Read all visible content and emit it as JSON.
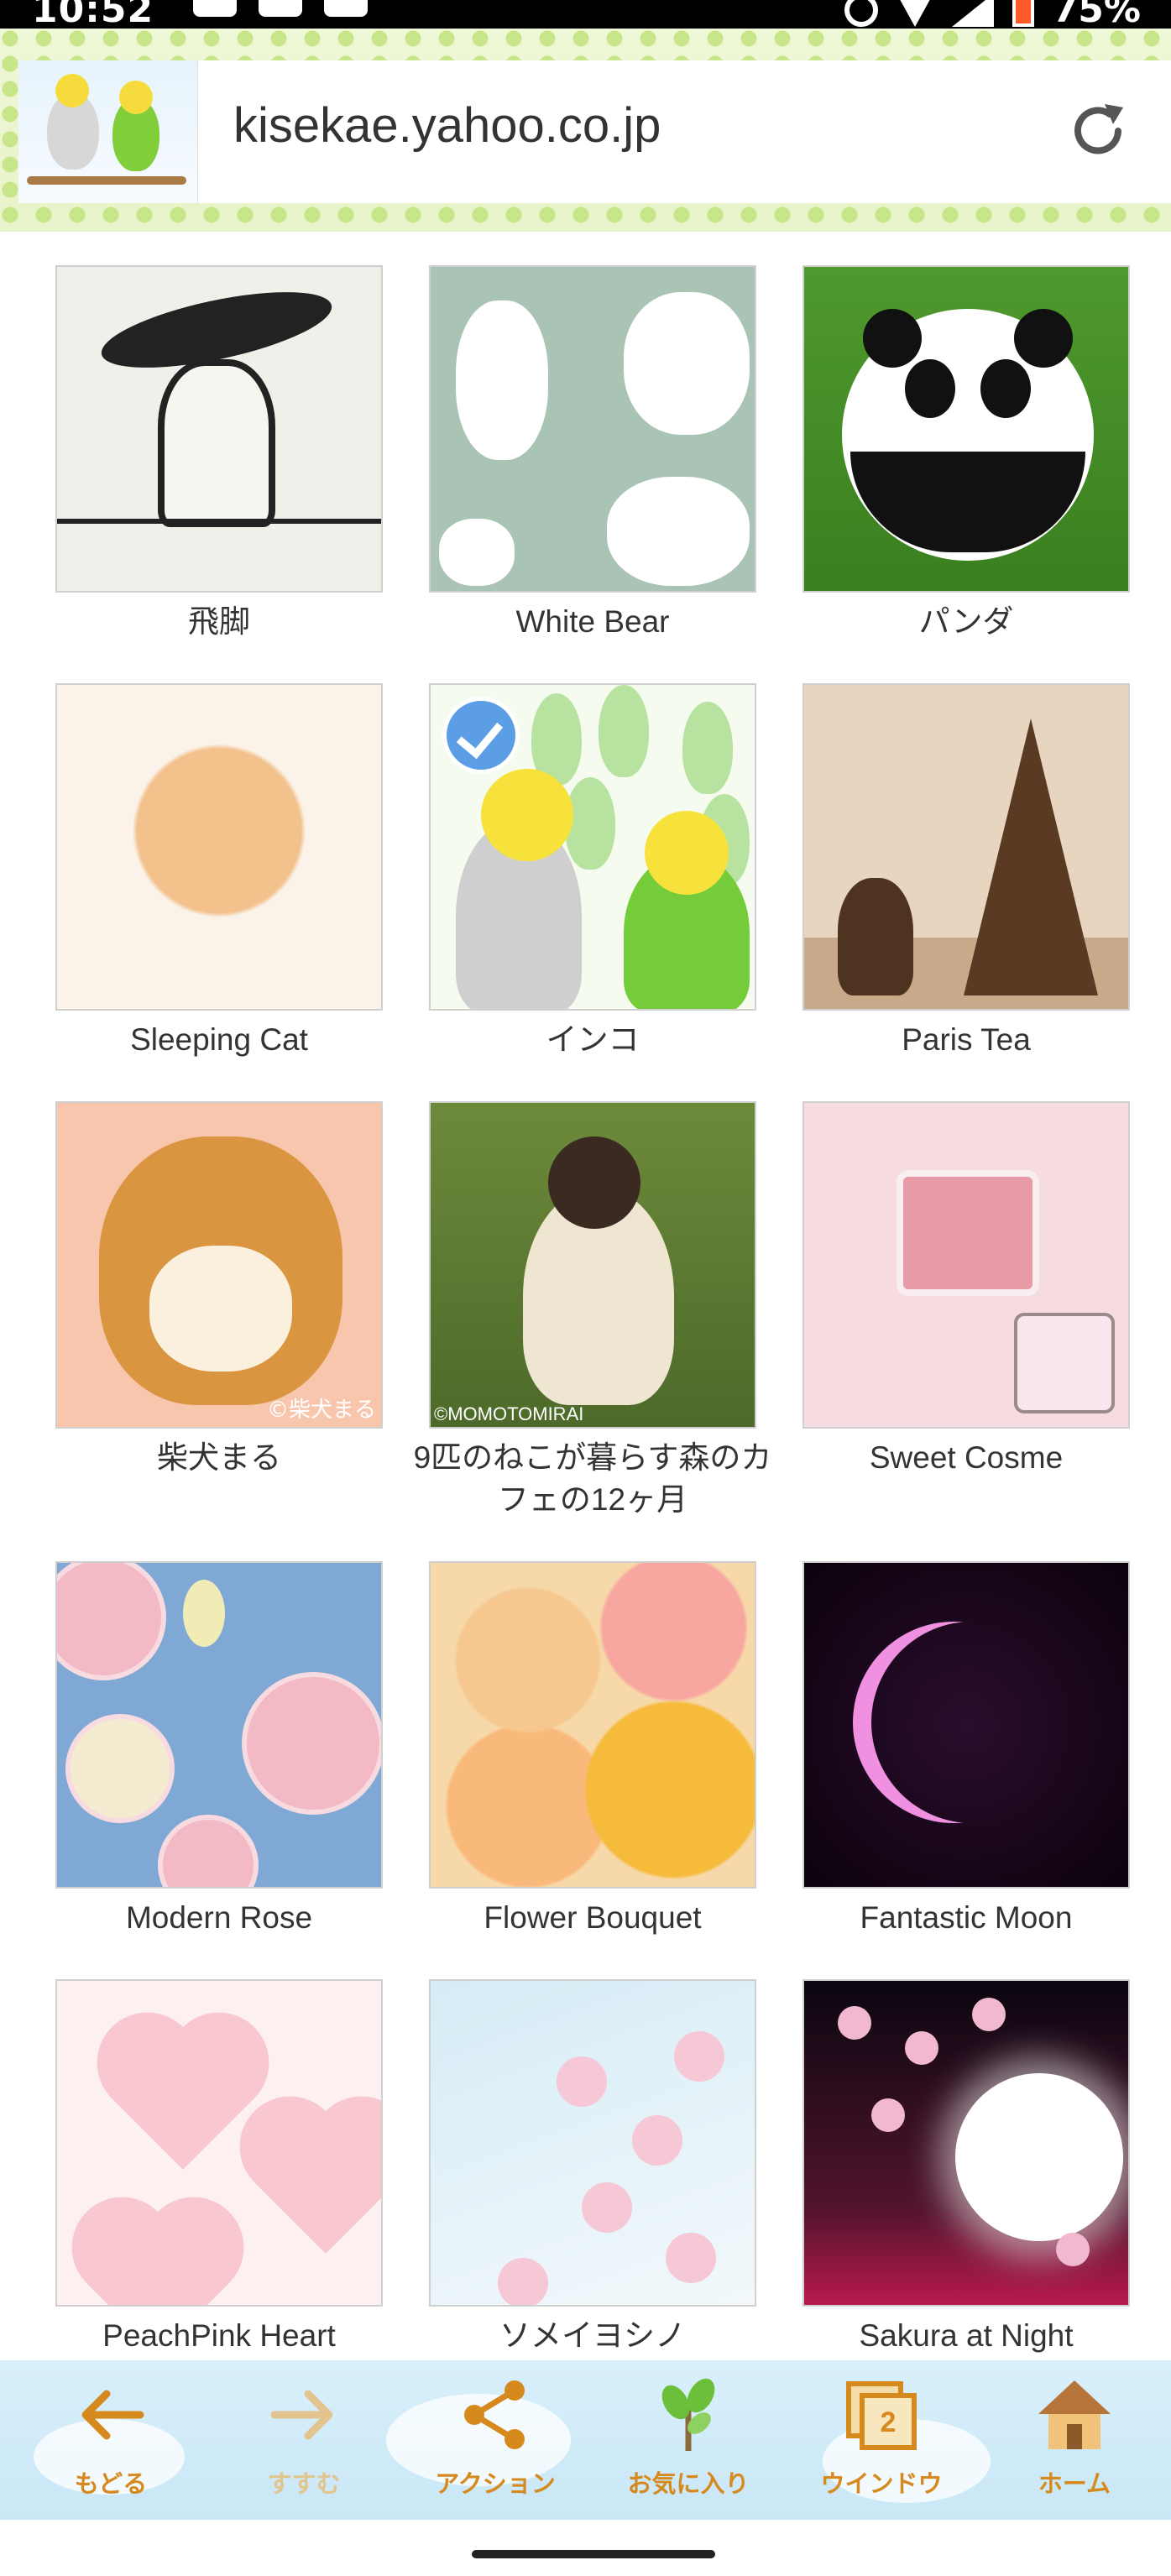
{
  "status_bar": {
    "time": "10:52",
    "battery": "75%"
  },
  "browser": {
    "url": "kisekae.yahoo.co.jp"
  },
  "themes": [
    {
      "name": "飛脚",
      "selected": false
    },
    {
      "name": "White Bear",
      "selected": false
    },
    {
      "name": "パンダ",
      "selected": false
    },
    {
      "name": "Sleeping Cat",
      "selected": false
    },
    {
      "name": "インコ",
      "selected": true
    },
    {
      "name": "Paris Tea",
      "selected": false
    },
    {
      "name": "柴犬まる",
      "selected": false,
      "credit": "©柴犬まる"
    },
    {
      "name": "9匹のねこが暮らす森のカフェの12ヶ月",
      "selected": false,
      "credit": "©MOMOTOMIRAI"
    },
    {
      "name": "Sweet Cosme",
      "selected": false
    },
    {
      "name": "Modern Rose",
      "selected": false
    },
    {
      "name": "Flower Bouquet",
      "selected": false
    },
    {
      "name": "Fantastic Moon",
      "selected": false
    },
    {
      "name": "PeachPink Heart",
      "selected": false
    },
    {
      "name": "ソメイヨシノ",
      "selected": false
    },
    {
      "name": "Sakura at Night",
      "selected": false
    }
  ],
  "toolbar": {
    "back": "もどる",
    "forward": "すすむ",
    "action": "アクション",
    "favorites": "お気に入り",
    "window": "ウインドウ",
    "window_count": "2",
    "home": "ホーム"
  },
  "colors": {
    "toolbar_label": "#d68a1e",
    "toolbar_label_disabled": "#e2c48f",
    "selected_check": "#5b9ee6"
  }
}
